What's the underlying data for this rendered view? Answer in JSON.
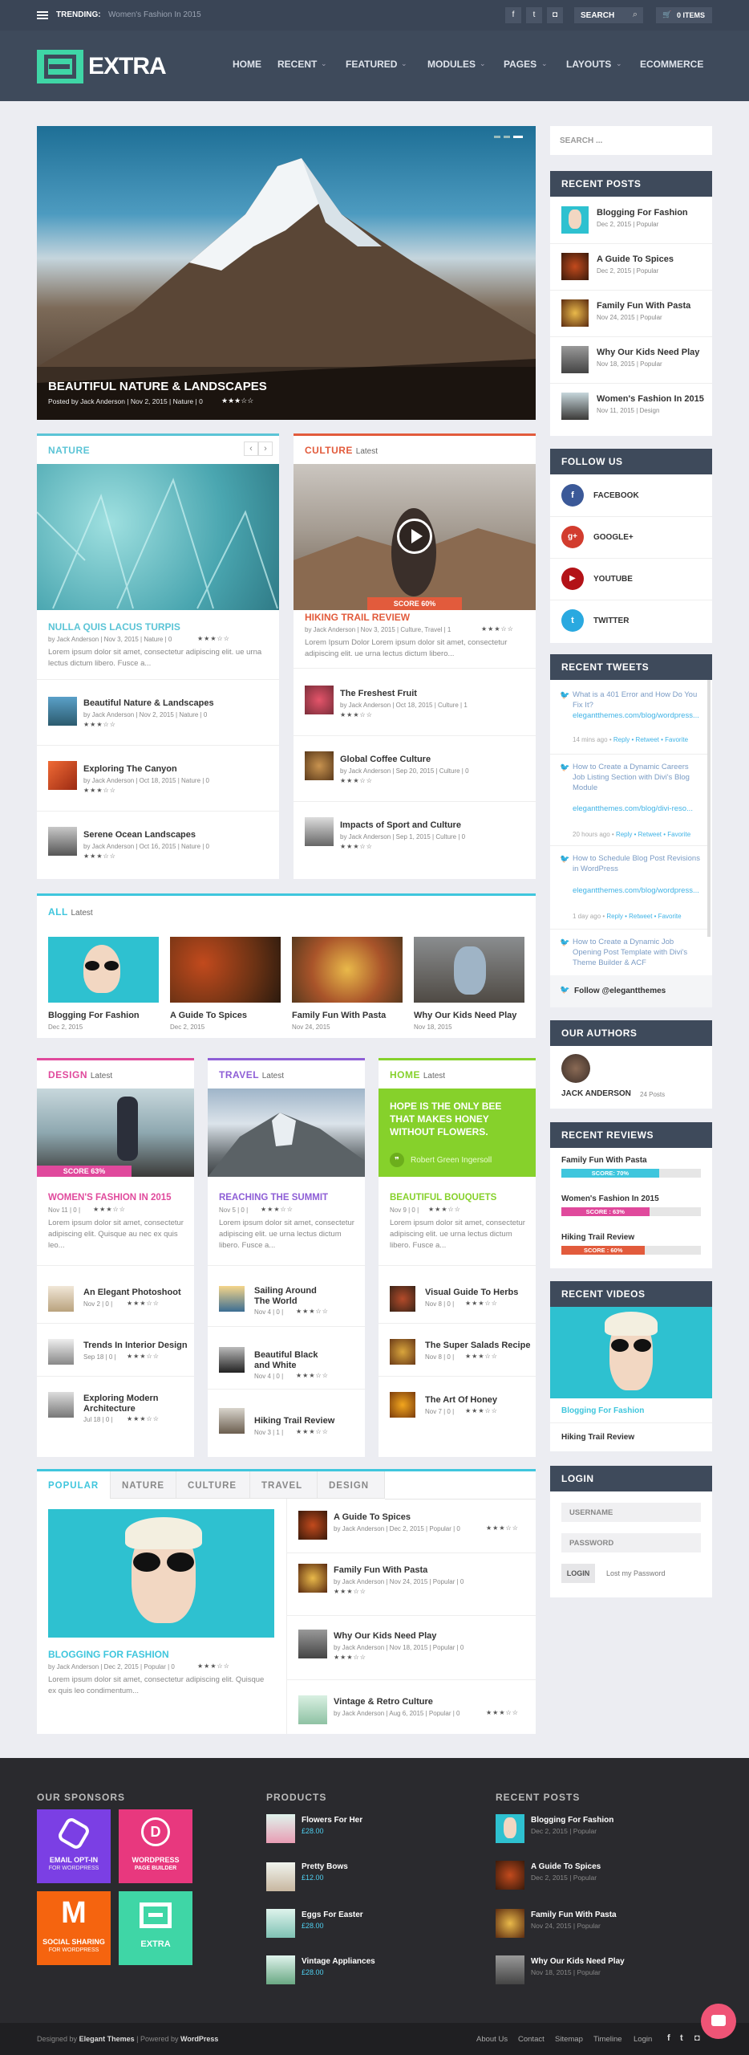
{
  "colors": {
    "accent": "#3fd6b0",
    "nature": "#5bc4d6",
    "culture": "#e25b3c",
    "design": "#e0499c",
    "travel": "#8e5ed6",
    "home": "#86d12b",
    "all": "#3fc6dd"
  },
  "topbar": {
    "trending_label": "TRENDING:",
    "trending_value": "Women's Fashion In 2015",
    "search_label": "SEARCH",
    "cart_label": "0 ITEMS"
  },
  "header": {
    "logo_text": "EXTRA",
    "nav": [
      "HOME",
      "RECENT",
      "FEATURED",
      "MODULES",
      "PAGES",
      "LAYOUTS",
      "ECOMMERCE"
    ]
  },
  "hero": {
    "title": "BEAUTIFUL NATURE & LANDSCAPES",
    "meta": "Posted by Jack Anderson | Nov 2, 2015 | Nature | 0"
  },
  "nature": {
    "title": "NATURE",
    "main_title": "NULLA QUIS LACUS TURPIS",
    "main_meta": "by Jack Anderson | Nov 3, 2015 | Nature | 0",
    "lorem": "Lorem ipsum dolor sit amet, consectetur adipiscing elit. ue urna lectus dictum libero. Fusce a...",
    "items": [
      {
        "title": "Beautiful Nature & Landscapes",
        "meta": "by Jack Anderson | Nov 2, 2015 | Nature | 0"
      },
      {
        "title": "Exploring The Canyon",
        "meta": "by Jack Anderson | Oct 18, 2015 | Nature | 0"
      },
      {
        "title": "Serene Ocean Landscapes",
        "meta": "by Jack Anderson | Oct 16, 2015 | Nature | 0"
      }
    ]
  },
  "culture": {
    "title": "CULTURE",
    "latest": "Latest",
    "score": "SCORE 60%",
    "main_title": "HIKING TRAIL REVIEW",
    "main_meta": "by Jack Anderson | Nov 3, 2015 | Culture, Travel | 1",
    "lorem": "Lorem Ipsum Dolor Lorem ipsum dolor sit amet, consectetur adipiscing elit. ue urna lectus dictum libero...",
    "items": [
      {
        "title": "The Freshest Fruit",
        "meta": "by Jack Anderson | Oct 18, 2015 | Culture | 1"
      },
      {
        "title": "Global Coffee Culture",
        "meta": "by Jack Anderson | Sep 20, 2015 | Culture | 0"
      },
      {
        "title": "Impacts of Sport and Culture",
        "meta": "by Jack Anderson | Sep 1, 2015 | Culture | 0"
      }
    ]
  },
  "all": {
    "title": "ALL",
    "latest": "Latest",
    "items": [
      {
        "title": "Blogging For Fashion",
        "date": "Dec 2, 2015"
      },
      {
        "title": "A Guide To Spices",
        "date": "Dec 2, 2015"
      },
      {
        "title": "Family Fun With Pasta",
        "date": "Nov 24, 2015"
      },
      {
        "title": "Why Our Kids Need Play",
        "date": "Nov 18, 2015"
      }
    ]
  },
  "design": {
    "title": "DESIGN",
    "latest": "Latest",
    "score": "SCORE 63%",
    "main_title": "WOMEN'S FASHION IN 2015",
    "main_meta": "Nov 11 | 0 |",
    "lorem": "Lorem ipsum dolor sit amet, consectetur adipiscing elit. Quisque au nec ex quis leo...",
    "items": [
      {
        "title": "An Elegant Photoshoot",
        "meta": "Nov 2 | 0 |"
      },
      {
        "title": "Trends In Interior Design",
        "meta": "Sep 18 | 0 |"
      },
      {
        "title": "Exploring Modern Architecture",
        "meta": "Jul 18 | 0 |"
      }
    ]
  },
  "travel": {
    "title": "TRAVEL",
    "latest": "Latest",
    "main_title": "REACHING THE SUMMIT",
    "main_meta": "Nov 5 | 0 |",
    "lorem": "Lorem ipsum dolor sit amet, consectetur adipiscing elit. ue urna lectus dictum libero. Fusce a...",
    "items": [
      {
        "title": "Sailing Around The World",
        "meta": "Nov 4 | 0 |"
      },
      {
        "title": "Beautiful Black and White",
        "meta": "Nov 4 | 0 |"
      },
      {
        "title": "Hiking Trail Review",
        "meta": "Nov 3 | 1 |"
      }
    ]
  },
  "home": {
    "title": "HOME",
    "latest": "Latest",
    "quote": "HOPE IS THE ONLY BEE THAT MAKES HONEY WITHOUT FLOWERS.",
    "quote_author": "Robert Green Ingersoll",
    "main_title": "BEAUTIFUL BOUQUETS",
    "main_meta": "Nov 9 | 0 |",
    "lorem": "Lorem ipsum dolor sit amet, consectetur adipiscing elit. ue urna lectus dictum libero. Fusce a...",
    "items": [
      {
        "title": "Visual Guide To Herbs",
        "meta": "Nov 8 | 0 |"
      },
      {
        "title": "The Super Salads Recipe",
        "meta": "Nov 8 | 0 |"
      },
      {
        "title": "The Art Of Honey",
        "meta": "Nov 7 | 0 |"
      }
    ]
  },
  "tabs": {
    "labels": [
      "POPULAR",
      "NATURE",
      "CULTURE",
      "TRAVEL",
      "DESIGN"
    ],
    "main_title": "BLOGGING FOR FASHION",
    "main_meta": "by Jack Anderson | Dec 2, 2015 | Popular | 0",
    "lorem": "Lorem ipsum dolor sit amet, consectetur adipiscing elit. Quisque ex quis leo condimentum...",
    "items": [
      {
        "title": "A Guide To Spices",
        "meta": "by Jack Anderson | Dec 2, 2015 | Popular | 0"
      },
      {
        "title": "Family Fun With Pasta",
        "meta": "by Jack Anderson | Nov 24, 2015 | Popular | 0"
      },
      {
        "title": "Why Our Kids Need Play",
        "meta": "by Jack Anderson | Nov 18, 2015 | Popular | 0"
      },
      {
        "title": "Vintage & Retro Culture",
        "meta": "by Jack Anderson | Aug 6, 2015 | Popular | 0"
      }
    ]
  },
  "sidebar": {
    "search_placeholder": "SEARCH ...",
    "recent_posts": {
      "title": "RECENT POSTS",
      "items": [
        {
          "title": "Blogging For Fashion",
          "meta": "Dec 2, 2015 | Popular"
        },
        {
          "title": "A Guide To Spices",
          "meta": "Dec 2, 2015 | Popular"
        },
        {
          "title": "Family Fun With Pasta",
          "meta": "Nov 24, 2015 | Popular"
        },
        {
          "title": "Why Our Kids Need Play",
          "meta": "Nov 18, 2015 | Popular"
        },
        {
          "title": "Women's Fashion In 2015",
          "meta": "Nov 11, 2015 | Design"
        }
      ]
    },
    "follow": {
      "title": "FOLLOW US",
      "items": [
        "FACEBOOK",
        "GOOGLE+",
        "YOUTUBE",
        "TWITTER"
      ]
    },
    "tweets": {
      "title": "RECENT TWEETS",
      "follow_label": "Follow @elegantthemes",
      "items": [
        {
          "text": "What is a 401 Error and How Do You Fix It?",
          "link": "elegantthemes.com/blog/wordpress...",
          "time": "14 mins ago"
        },
        {
          "text": "How to Create a Dynamic Careers Job Listing Section with Divi's Blog Module",
          "link": "elegantthemes.com/blog/divi-reso...",
          "time": "20 hours ago"
        },
        {
          "text": "How to Schedule Blog Post Revisions in WordPress",
          "link": "elegantthemes.com/blog/wordpress...",
          "time": "1 day ago"
        },
        {
          "text": "How to Create a Dynamic Job Opening Post Template with Divi's Theme Builder & ACF",
          "link": "",
          "time": ""
        }
      ],
      "actions": "Reply • Retweet • Favorite"
    },
    "authors": {
      "title": "OUR AUTHORS",
      "name": "JACK ANDERSON",
      "posts": "24 Posts"
    },
    "reviews": {
      "title": "RECENT REVIEWS",
      "items": [
        {
          "title": "Family Fun With Pasta",
          "score": "SCORE: 70%",
          "value": 70,
          "color": "#3fc6dd"
        },
        {
          "title": "Women's Fashion In 2015",
          "score": "SCORE : 63%",
          "value": 63,
          "color": "#e0499c"
        },
        {
          "title": "Hiking Trail Review",
          "score": "SCORE : 60%",
          "value": 60,
          "color": "#e25b3c"
        }
      ]
    },
    "videos": {
      "title": "RECENT VIDEOS",
      "items": [
        "Blogging For Fashion",
        "Hiking Trail Review"
      ]
    },
    "login": {
      "title": "LOGIN",
      "username": "USERNAME",
      "password": "PASSWORD",
      "button": "LOGIN",
      "lost": "Lost my Password"
    }
  },
  "footer": {
    "sponsors_title": "OUR SPONSORS",
    "sponsors": [
      {
        "name": "EMAIL OPT-IN",
        "sub": "FOR WORDPRESS",
        "color": "#7b3fe4"
      },
      {
        "name": "WORDPRESS",
        "sub": "PAGE BUILDER",
        "color": "#e8387e"
      },
      {
        "name": "SOCIAL SHARING",
        "sub": "FOR WORDPRESS",
        "color": "#f5640f"
      },
      {
        "name": "EXTRA",
        "sub": "",
        "color": "#3fd6a6"
      }
    ],
    "products_title": "PRODUCTS",
    "products": [
      {
        "name": "Flowers For Her",
        "price": "£28.00"
      },
      {
        "name": "Pretty Bows",
        "price": "£12.00"
      },
      {
        "name": "Eggs For Easter",
        "price": "£28.00"
      },
      {
        "name": "Vintage Appliances",
        "price": "£28.00"
      }
    ],
    "recent_title": "RECENT POSTS",
    "recent": [
      {
        "title": "Blogging For Fashion",
        "meta": "Dec 2, 2015 | Popular"
      },
      {
        "title": "A Guide To Spices",
        "meta": "Dec 2, 2015 | Popular"
      },
      {
        "title": "Family Fun With Pasta",
        "meta": "Nov 24, 2015 | Popular"
      },
      {
        "title": "Why Our Kids Need Play",
        "meta": "Nov 18, 2015 | Popular"
      }
    ],
    "credit_designed": "Designed by",
    "credit_et": "Elegant Themes",
    "credit_powered": "| Powered by",
    "credit_wp": "WordPress",
    "links": [
      "About Us",
      "Contact",
      "Sitemap",
      "Timeline",
      "Login"
    ]
  }
}
